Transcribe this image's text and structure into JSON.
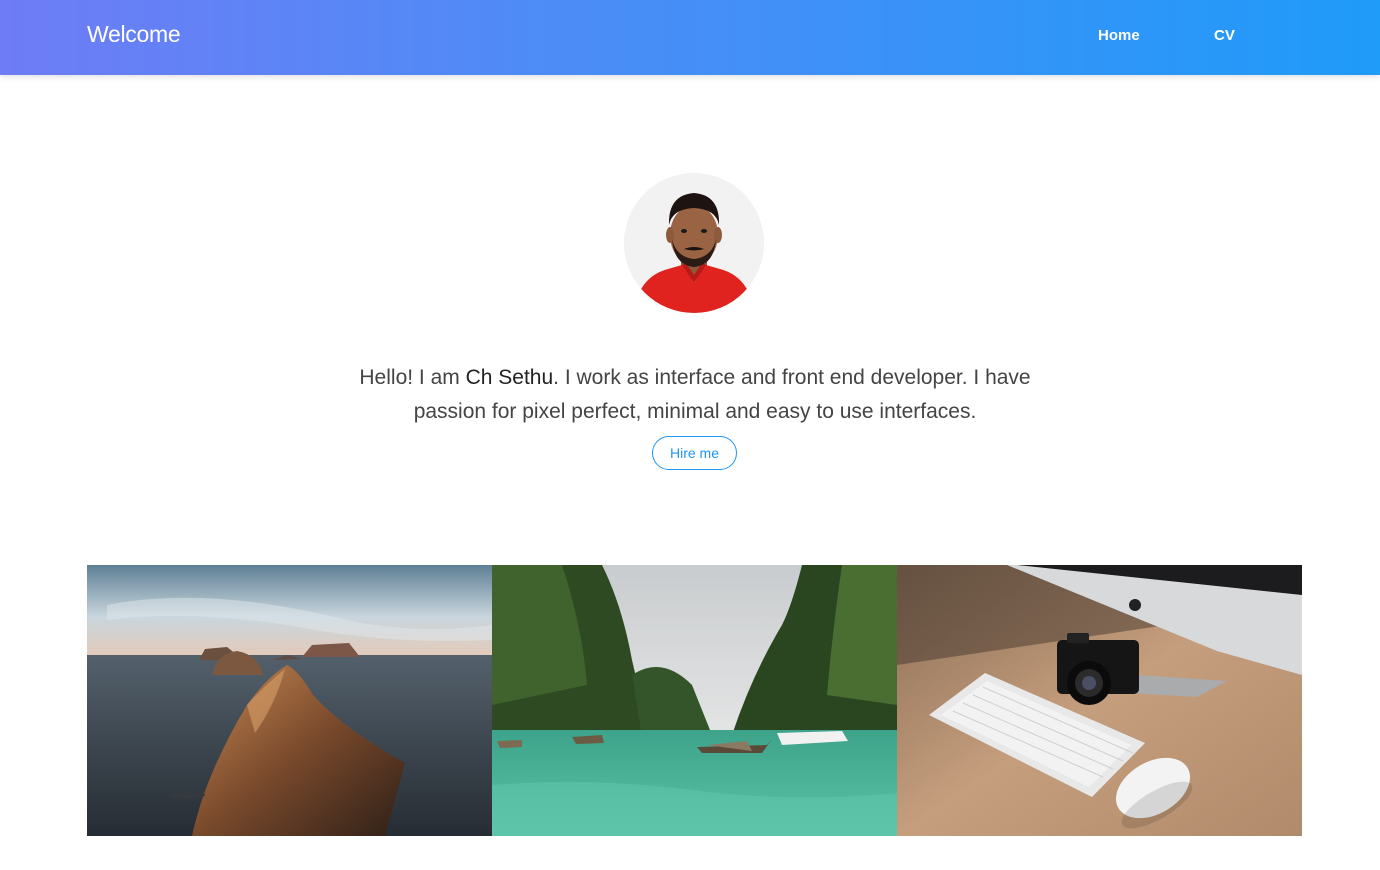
{
  "nav": {
    "brand": "Welcome",
    "links": [
      {
        "label": "Home"
      },
      {
        "label": "CV"
      }
    ]
  },
  "hero": {
    "intro_prefix": "Hello! I am ",
    "name": "Ch Sethu",
    "intro_suffix": ". I work as interface and front end developer. I have passion for pixel perfect, minimal and easy to use interfaces.",
    "hire_label": "Hire me"
  },
  "colors": {
    "accent": "#2196f3",
    "nav_gradient_start": "#6e7cf5",
    "nav_gradient_end": "#1f9bf9"
  },
  "gallery": [
    {
      "icon": "sea-cliff-photo"
    },
    {
      "icon": "lagoon-boats-photo"
    },
    {
      "icon": "desk-computer-camera-photo"
    }
  ]
}
